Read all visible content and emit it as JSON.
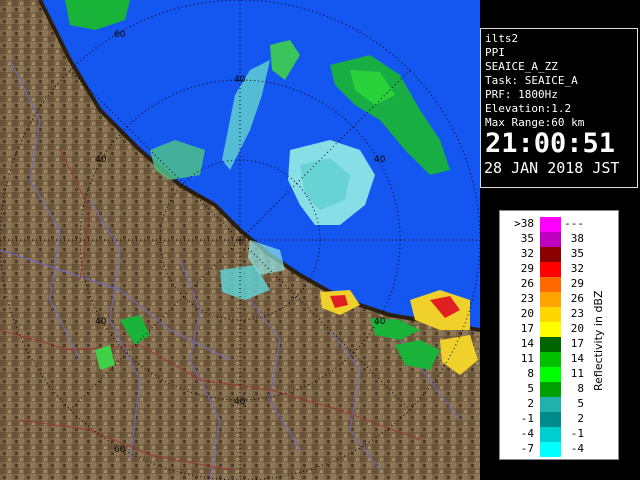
{
  "info": {
    "lines": [
      "ilts2",
      "PPI",
      "SEAICE_A_ZZ",
      "Task: SEAICE_A",
      "PRF: 1800Hz",
      "Elevation:1.2",
      "Max Range:60 km"
    ],
    "time": "21:00:51",
    "date": "28 JAN 2018 JST"
  },
  "range_rings": [
    {
      "label": "40"
    },
    {
      "label": "60"
    },
    {
      "label": "40"
    },
    {
      "label": "40"
    },
    {
      "label": "40"
    },
    {
      "label": "40"
    },
    {
      "label": "60"
    },
    {
      "label": "40"
    }
  ],
  "legend": {
    "unit": "Reflectivity in dBZ",
    "rows": [
      {
        "lo": ">38",
        "hi": "---",
        "color": "#ff00ff"
      },
      {
        "lo": "35",
        "hi": "38",
        "color": "#c000c0"
      },
      {
        "lo": "32",
        "hi": "35",
        "color": "#8b0000"
      },
      {
        "lo": "29",
        "hi": "32",
        "color": "#ff0000"
      },
      {
        "lo": "26",
        "hi": "29",
        "color": "#ff6a00"
      },
      {
        "lo": "23",
        "hi": "26",
        "color": "#ffa500"
      },
      {
        "lo": "20",
        "hi": "23",
        "color": "#ffd700"
      },
      {
        "lo": "17",
        "hi": "20",
        "color": "#ffff00"
      },
      {
        "lo": "14",
        "hi": "17",
        "color": "#006400"
      },
      {
        "lo": "11",
        "hi": "14",
        "color": "#00c000"
      },
      {
        "lo": "8",
        "hi": "11",
        "color": "#00ff00"
      },
      {
        "lo": "5",
        "hi": "8",
        "color": "#00a000"
      },
      {
        "lo": "2",
        "hi": "5",
        "color": "#20b2aa"
      },
      {
        "lo": "-1",
        "hi": "2",
        "color": "#008b8b"
      },
      {
        "lo": "-4",
        "hi": "-1",
        "color": "#00cdcd"
      },
      {
        "lo": "-7",
        "hi": "-4",
        "color": "#00ffff"
      }
    ]
  },
  "colors": {
    "sea": "#1456f0",
    "land": "#7a6446",
    "coast_band": "#2a1f10",
    "echo_light": "#8ee6e6",
    "echo_green": "#19b33a",
    "echo_yellow": "#f0d02a",
    "echo_red": "#e02020",
    "rivers": "#6b6bd8",
    "roads": "#a03030"
  }
}
